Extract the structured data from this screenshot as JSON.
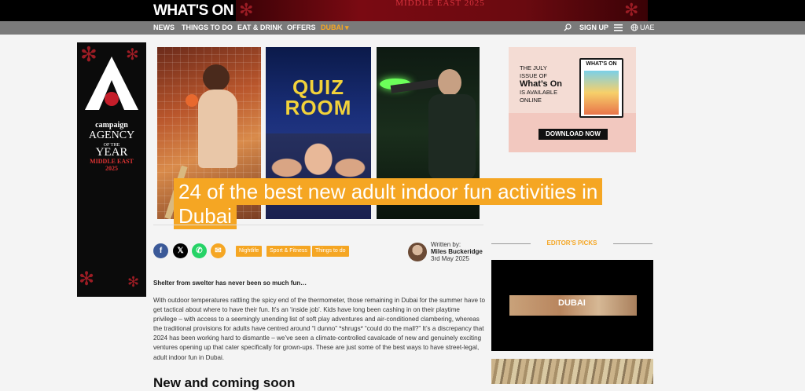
{
  "header": {
    "logo": "WHAT'S ON",
    "banner_text": "MIDDLE EAST 2025"
  },
  "nav": {
    "items": [
      "NEWS",
      "THINGS TO DO",
      "EAT & DRINK",
      "OFFERS"
    ],
    "city": "DUBAI",
    "signup": "SIGN UP",
    "region": "UAE"
  },
  "sidebar_ad": {
    "brand": "campaign",
    "line1": "AGENCY",
    "line2": "OF THE",
    "line3": "YEAR",
    "line4": "MIDDLE EAST",
    "line5": "2025"
  },
  "hero": {
    "panel2_text": "QUIZ ROOM",
    "title": "24 of the best new adult indoor fun activities in Dubai"
  },
  "tags": [
    "Nightlife",
    "Sport & Fitness",
    "Things to do"
  ],
  "author": {
    "written_by": "Written by:",
    "name": "Miles Buckeridge",
    "date": "3rd May 2025"
  },
  "article": {
    "intro": "Shelter from swelter has never been so much fun…",
    "body": "With outdoor temperatures rattling the spicy end of the thermometer, those remaining in Dubai for the summer have to get tactical about where to have their fun. It’s an ‘inside job’. Kids have long been cashing in on their playtime privilege – with access to a seemingly unending list of soft play adventures and air-conditioned clambering, whereas the traditional provisions for adults have centred around “I dunno” *shrugs* “could do the mall?” It’s a discrepancy that 2024 has been working hard to dismantle – we’ve seen a climate-controlled cavalcade of new and genuinely exciting ventures opening up that cater specifically for grown-ups. These are just some of the best ways to have street-legal, adult indoor fun in Dubai.",
    "subheading": "New and coming soon"
  },
  "right_ad": {
    "line1": "THE JULY",
    "line2": "ISSUE OF",
    "line3": "What’s On",
    "line4": "IS AVAILABLE",
    "line5": "ONLINE",
    "magazine_logo": "WHAT'S ON",
    "button": "DOWNLOAD NOW"
  },
  "editors_picks": {
    "label": "EDITOR'S PICKS",
    "video_text": "DUBAI"
  },
  "colors": {
    "accent": "#f5a623",
    "nav_bg": "#7a7a7a",
    "facebook": "#3b5998",
    "x": "#000000",
    "whatsapp": "#25d366",
    "email": "#f5a623"
  }
}
